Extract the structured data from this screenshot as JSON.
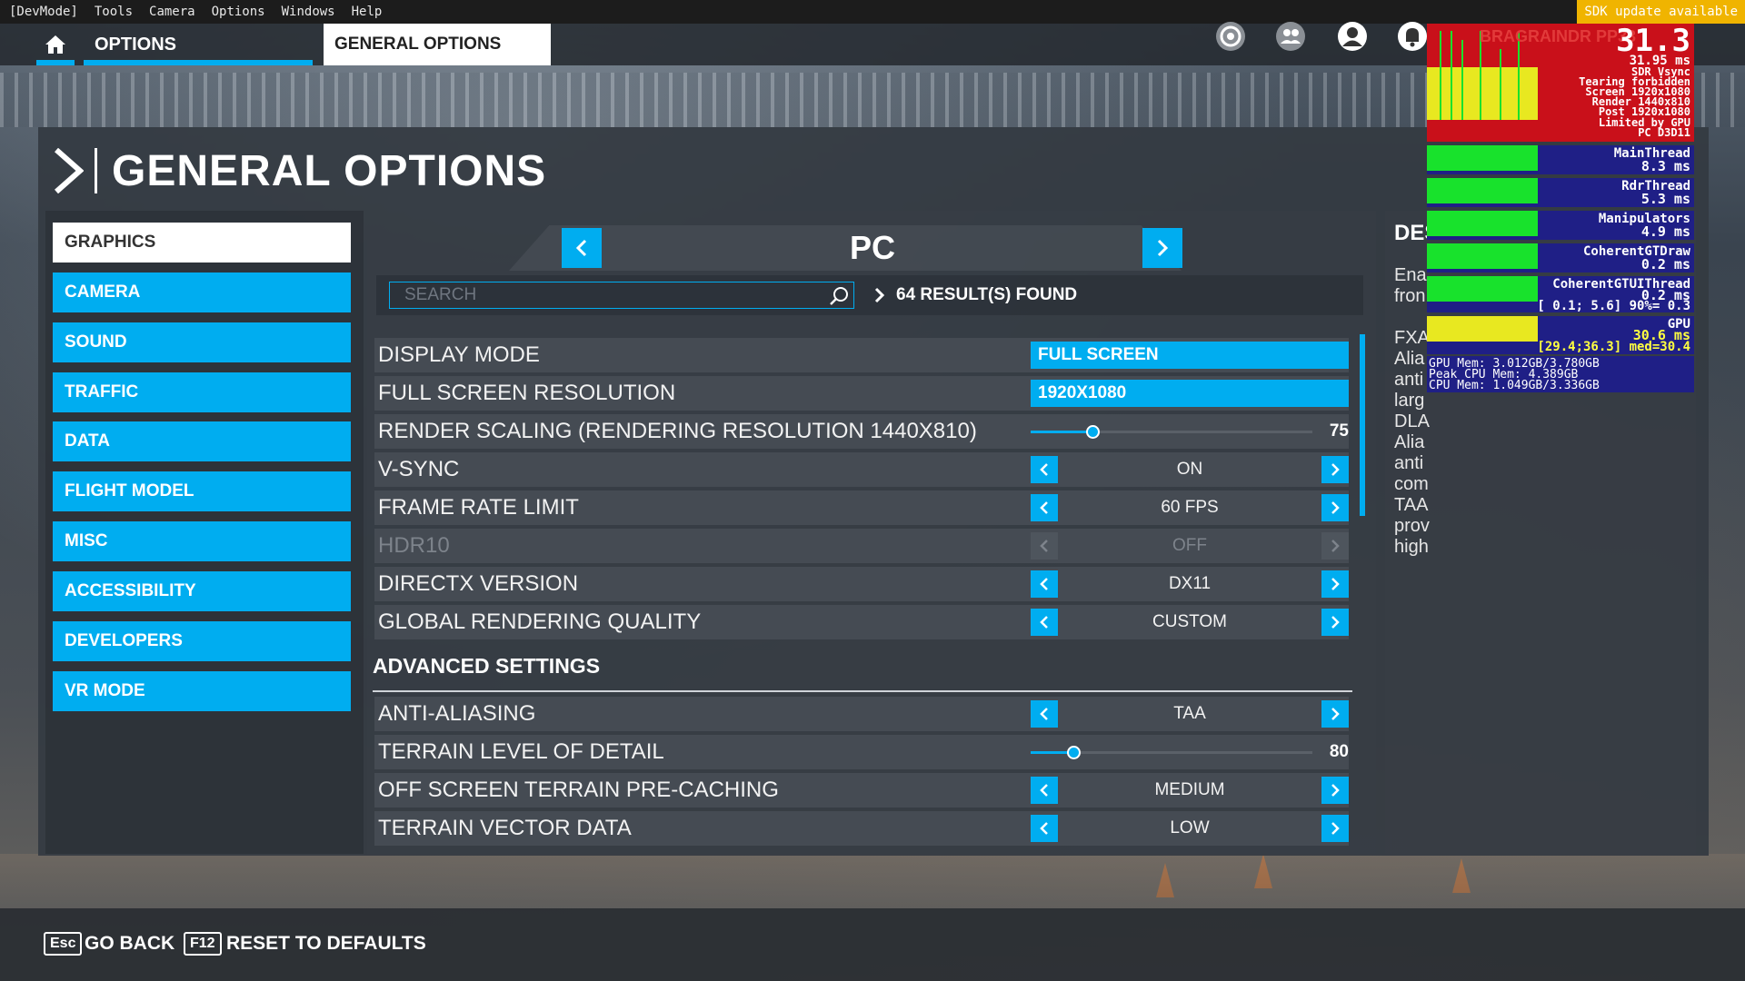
{
  "menubar": {
    "items": [
      "[DevMode]",
      "Tools",
      "Camera",
      "Options",
      "Windows",
      "Help"
    ],
    "sdk_badge": "SDK update available"
  },
  "header": {
    "home_icon": "home-icon",
    "tab_options": "OPTIONS",
    "tab_general": "GENERAL OPTIONS",
    "icons": [
      "activity-icon",
      "friends-icon",
      "profile-icon",
      "notification-icon"
    ],
    "username": "BRAGRAINDR PP33"
  },
  "page": {
    "title": "GENERAL OPTIONS"
  },
  "sidebar": {
    "items": [
      {
        "label": "GRAPHICS",
        "active": true
      },
      {
        "label": "CAMERA"
      },
      {
        "label": "SOUND"
      },
      {
        "label": "TRAFFIC"
      },
      {
        "label": "DATA"
      },
      {
        "label": "FLIGHT MODEL"
      },
      {
        "label": "MISC"
      },
      {
        "label": "ACCESSIBILITY"
      },
      {
        "label": "DEVELOPERS"
      },
      {
        "label": "VR MODE"
      }
    ]
  },
  "platform": {
    "label": "PC"
  },
  "search": {
    "placeholder": "SEARCH",
    "results": "64 RESULT(S) FOUND"
  },
  "settings": {
    "display_mode": {
      "label": "DISPLAY MODE",
      "value": "FULL SCREEN"
    },
    "resolution": {
      "label": "FULL SCREEN RESOLUTION",
      "value": "1920X1080"
    },
    "render_scaling": {
      "label": "RENDER SCALING (RENDERING RESOLUTION 1440X810)",
      "value": "75",
      "fraction": 0.22
    },
    "vsync": {
      "label": "V-SYNC",
      "value": "ON"
    },
    "frame_rate": {
      "label": "FRAME RATE LIMIT",
      "value": "60 FPS"
    },
    "hdr10": {
      "label": "HDR10",
      "value": "OFF"
    },
    "directx": {
      "label": "DIRECTX VERSION",
      "value": "DX11"
    },
    "global_quality": {
      "label": "GLOBAL RENDERING QUALITY",
      "value": "CUSTOM"
    }
  },
  "advanced": {
    "heading": "ADVANCED SETTINGS",
    "anti_aliasing": {
      "label": "ANTI-ALIASING",
      "value": "TAA"
    },
    "terrain_lod": {
      "label": "TERRAIN LEVEL OF DETAIL",
      "value": "80",
      "fraction": 0.15
    },
    "terrain_precache": {
      "label": "OFF SCREEN TERRAIN PRE-CACHING",
      "value": "MEDIUM"
    },
    "terrain_vector": {
      "label": "TERRAIN VECTOR DATA",
      "value": "LOW"
    }
  },
  "description": {
    "title": "DES",
    "lines": [
      "Ena",
      "fron",
      "",
      "FXA",
      "Alia",
      "anti",
      "larg",
      "DLA",
      "Alia",
      "anti",
      "com",
      "TAA",
      "prov",
      "high"
    ]
  },
  "debug": {
    "fps": "31.3",
    "frame_ms": "31.95 ms",
    "lines": [
      "SDR Vsync",
      "Tearing forbidden",
      "Screen 1920x1080",
      "Render 1440x810",
      "Post 1920x1080",
      "Limited by GPU",
      "PC D3D11"
    ],
    "threads": [
      {
        "name": "MainThread",
        "ms": "8.3 ms"
      },
      {
        "name": "RdrThread",
        "ms": "5.3 ms"
      },
      {
        "name": "Manipulators",
        "ms": "4.9 ms"
      },
      {
        "name": "CoherentGTDraw",
        "ms": "0.2 ms"
      },
      {
        "name": "CoherentGTUIThread",
        "ms": "0.2 ms",
        "extra": "[ 0.1; 5.6] 90%= 0.3"
      },
      {
        "name": "GPU",
        "ms": "30.6 ms",
        "extra": "[29.4;36.3] med=30.4"
      }
    ],
    "mem": [
      "GPU Mem: 3.012GB/3.780GB",
      "Peak CPU Mem: 4.389GB",
      "CPU Mem: 1.049GB/3.336GB"
    ]
  },
  "footer": {
    "back_key": "Esc",
    "back_label": "GO BACK",
    "reset_key": "F12",
    "reset_label": "RESET TO DEFAULTS"
  }
}
